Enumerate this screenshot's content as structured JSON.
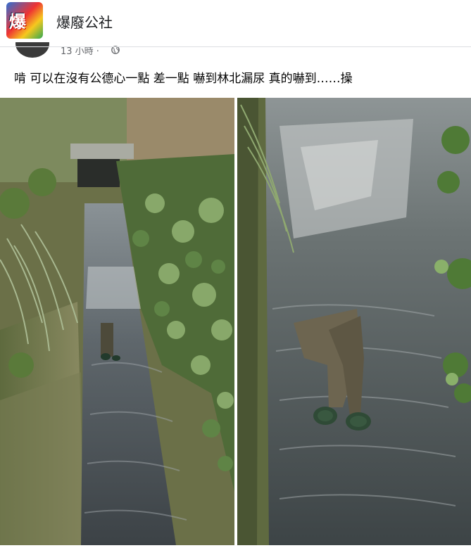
{
  "group": {
    "name": "爆廢公社",
    "avatar_text": "爆"
  },
  "post": {
    "timestamp": "13 小時 ·",
    "privacy_icon": "globe-icon",
    "text": "啃 可以在沒有公德心一點 差一點 嚇到林北漏尿 真的嚇到……操"
  },
  "photos": [
    {
      "scene": "drainage channel with vegetation and a culvert"
    },
    {
      "scene": "close-up of water with submerged legs and green shoes"
    }
  ]
}
